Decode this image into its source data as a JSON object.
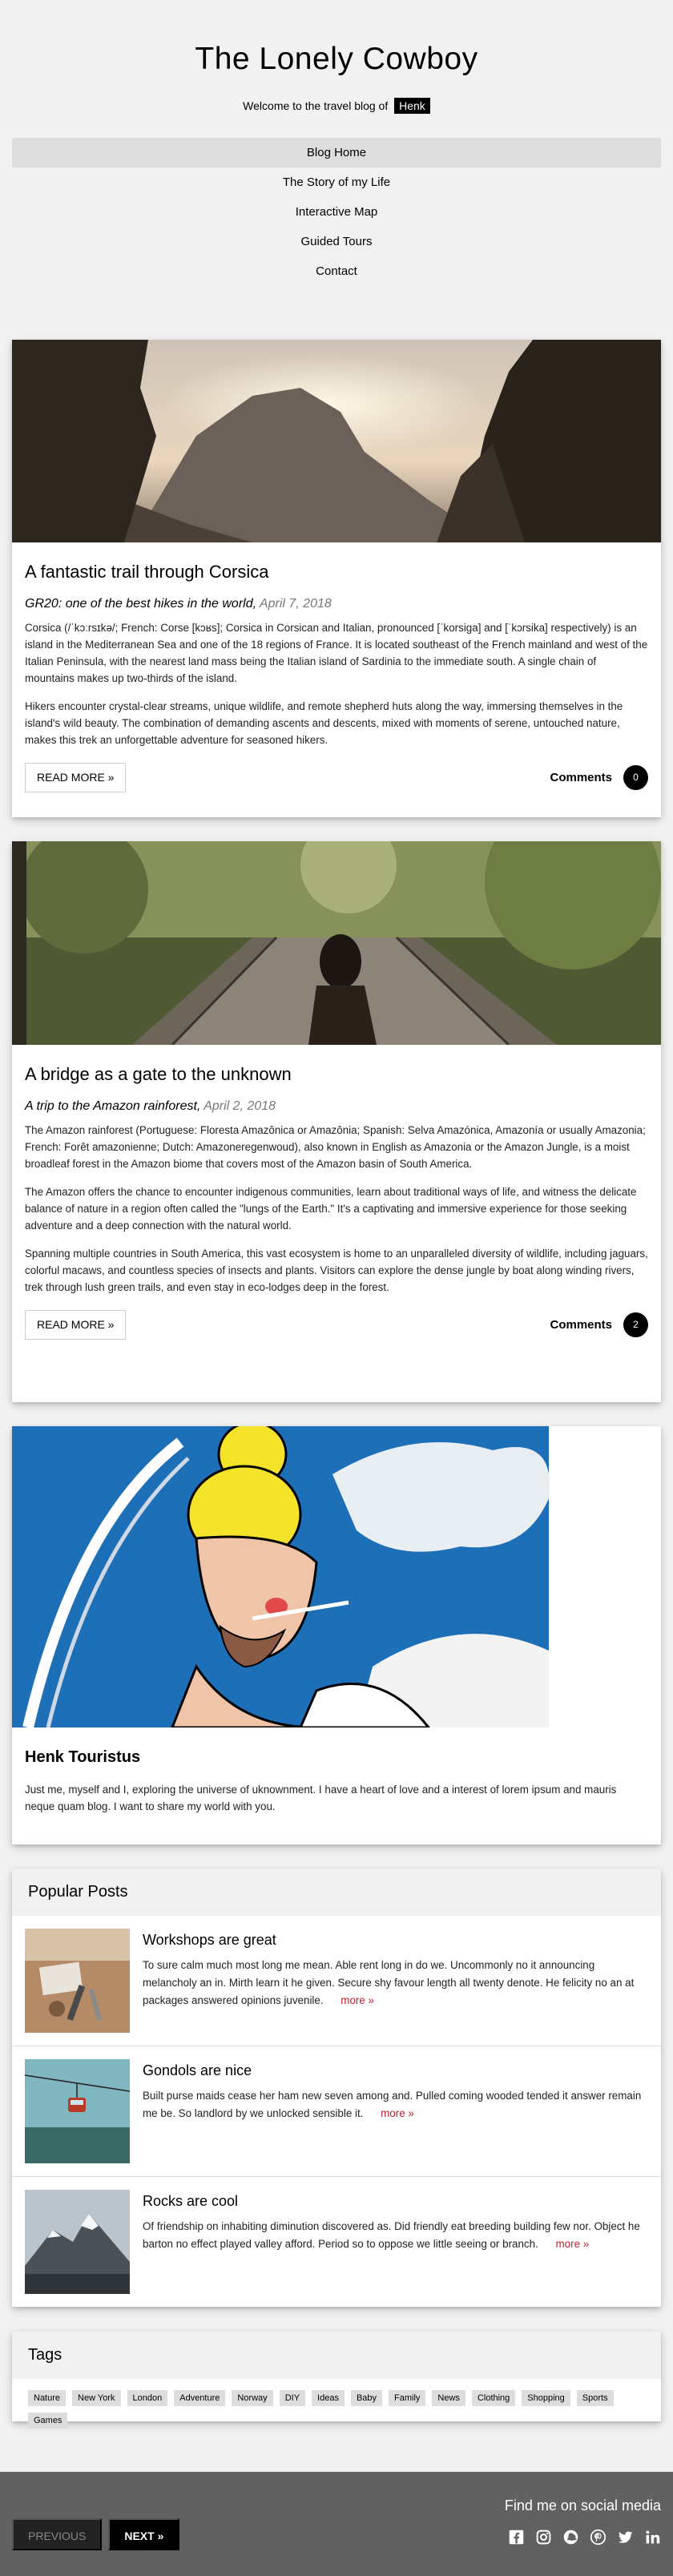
{
  "header": {
    "title": "The Lonely Cowboy",
    "tagline": "Welcome to the travel blog of",
    "author_tag": "Henk"
  },
  "nav": {
    "items": [
      {
        "label": "Blog Home"
      },
      {
        "label": "The Story of my Life"
      },
      {
        "label": "Interactive Map"
      },
      {
        "label": "Guided Tours"
      },
      {
        "label": "Contact"
      }
    ]
  },
  "posts": [
    {
      "title": "A fantastic trail through Corsica",
      "subtitle": "GR20: one of the best hikes in the world,",
      "date": "April 7, 2018",
      "paragraphs": [
        "Corsica (/ˈkɔːrsɪkə/; French: Corse [kɔʁs]; Corsica in Corsican and Italian, pronounced [ˈkorsiga] and [ˈkɔrsika] respectively) is an island in the Mediterranean Sea and one of the 18 regions of France. It is located southeast of the French mainland and west of the Italian Peninsula, with the nearest land mass being the Italian island of Sardinia to the immediate south. A single chain of mountains makes up two-thirds of the island.",
        "Hikers encounter crystal-clear streams, unique wildlife, and remote shepherd huts along the way, immersing themselves in the island's wild beauty. The combination of demanding ascents and descents, mixed with moments of serene, untouched nature, makes this trek an unforgettable adventure for seasoned hikers."
      ],
      "read_more": "READ MORE »",
      "comments_label": "Comments",
      "comments_count": "0"
    },
    {
      "title": "A bridge as a gate to the unknown",
      "subtitle": "A trip to the Amazon rainforest,",
      "date": "April 2, 2018",
      "paragraphs": [
        "The Amazon rainforest (Portuguese: Floresta Amazônica or Amazônia; Spanish: Selva Amazónica, Amazonía or usually Amazonia; French: Forêt amazonienne; Dutch: Amazoneregenwoud), also known in English as Amazonia or the Amazon Jungle, is a moist broadleaf forest in the Amazon biome that covers most of the Amazon basin of South America.",
        "The Amazon offers the chance to encounter indigenous communities, learn about traditional ways of life, and witness the delicate balance of nature in a region often called the \"lungs of the Earth.\" It's a captivating and immersive experience for those seeking adventure and a deep connection with the natural world.",
        "Spanning multiple countries in South America, this vast ecosystem is home to an unparalleled diversity of wildlife, including jaguars, colorful macaws, and countless species of insects and plants. Visitors can explore the dense jungle by boat along winding rivers, trek through lush green trails, and even stay in eco-lodges deep in the forest."
      ],
      "read_more": "READ MORE »",
      "comments_label": "Comments",
      "comments_count": "2"
    }
  ],
  "about": {
    "name": "Henk Touristus",
    "text": "Just me, myself and I, exploring the universe of uknownment. I have a heart of love and a interest of lorem ipsum and mauris neque quam blog. I want to share my world with you."
  },
  "popular": {
    "heading": "Popular Posts",
    "items": [
      {
        "title": "Workshops are great",
        "text": "To sure calm much most long me mean. Able rent long in do we. Uncommonly no it announcing melancholy an in. Mirth learn it he given. Secure shy favour length all twenty denote. He felicity no an at packages answered opinions juvenile.",
        "more": "more »"
      },
      {
        "title": "Gondols are nice",
        "text": "Built purse maids cease her ham new seven among and. Pulled coming wooded tended it answer remain me be. So landlord by we unlocked sensible it.",
        "more": "more »"
      },
      {
        "title": "Rocks are cool",
        "text": "Of friendship on inhabiting diminution discovered as. Did friendly eat breeding building few nor. Object he barton no effect played valley afford. Period so to oppose we little seeing or branch.",
        "more": "more »"
      }
    ]
  },
  "tags": {
    "heading": "Tags",
    "items": [
      "Nature",
      "New York",
      "London",
      "Adventure",
      "Norway",
      "DIY",
      "Ideas",
      "Baby",
      "Family",
      "News",
      "Clothing",
      "Shopping",
      "Sports",
      "Games"
    ]
  },
  "footer": {
    "prev": "PREVIOUS",
    "next": "NEXT »",
    "social_label": "Find me on social media",
    "social_icons": [
      "facebook-icon",
      "instagram-icon",
      "snapchat-icon",
      "pinterest-icon",
      "twitter-icon",
      "linkedin-icon"
    ]
  }
}
